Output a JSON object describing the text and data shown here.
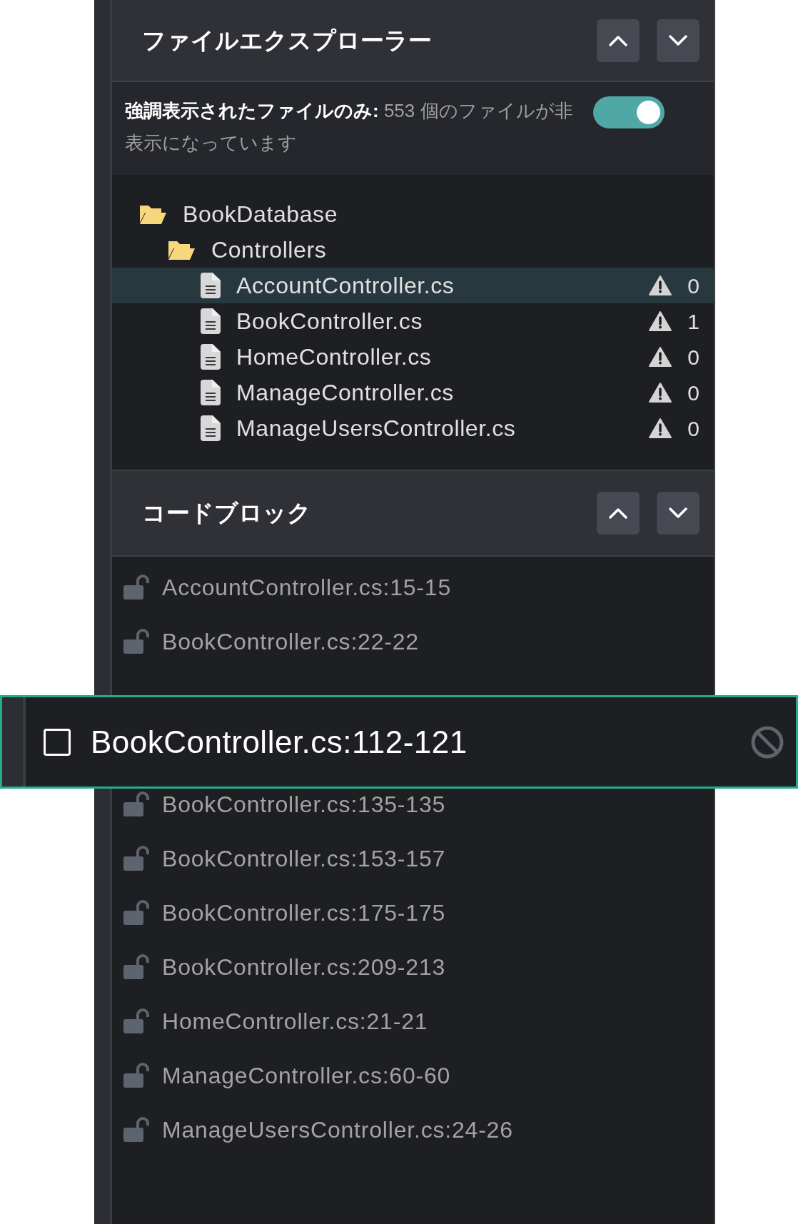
{
  "file_explorer": {
    "title": "ファイルエクスプローラー",
    "filter": {
      "label": "強調表示されたファイルのみ:",
      "detail": "553 個のファイルが非表示になっています",
      "on": true
    },
    "tree": [
      {
        "kind": "folder",
        "name": "BookDatabase",
        "selected": false,
        "children": [
          {
            "kind": "folder",
            "name": "Controllers",
            "selected": false,
            "children": [
              {
                "kind": "file",
                "name": "AccountController.cs",
                "warnings": "0",
                "selected": true
              },
              {
                "kind": "file",
                "name": "BookController.cs",
                "warnings": "1",
                "selected": false
              },
              {
                "kind": "file",
                "name": "HomeController.cs",
                "warnings": "0",
                "selected": false
              },
              {
                "kind": "file",
                "name": "ManageController.cs",
                "warnings": "0",
                "selected": false
              },
              {
                "kind": "file",
                "name": "ManageUsersController.cs",
                "warnings": "0",
                "selected": false
              }
            ]
          }
        ]
      }
    ]
  },
  "code_blocks": {
    "title": "コードブロック",
    "items": [
      {
        "label": "AccountController.cs:15-15",
        "locked": false
      },
      {
        "label": "BookController.cs:22-22",
        "locked": false
      },
      {
        "label": "BookController.cs:135-135",
        "locked": false
      },
      {
        "label": "BookController.cs:153-157",
        "locked": false
      },
      {
        "label": "BookController.cs:175-175",
        "locked": false
      },
      {
        "label": "BookController.cs:209-213",
        "locked": false
      },
      {
        "label": "HomeController.cs:21-21",
        "locked": false
      },
      {
        "label": "ManageController.cs:60-60",
        "locked": false
      },
      {
        "label": "ManageUsersController.cs:24-26",
        "locked": false
      }
    ]
  },
  "dragged_item": {
    "label": "BookController.cs:112-121",
    "checked": false
  }
}
